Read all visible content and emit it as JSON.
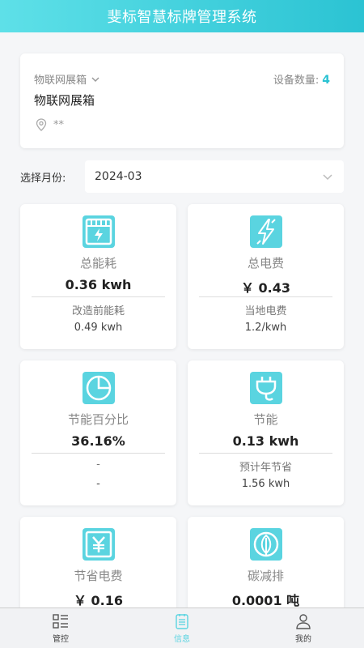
{
  "app": {
    "title": "斐标智慧标牌管理系统"
  },
  "device": {
    "selector_label": "物联网展箱",
    "count_label": "设备数量:",
    "count": "4",
    "name": "物联网展箱",
    "location": "**"
  },
  "month": {
    "label": "选择月份:",
    "value": "2024-03"
  },
  "cards": [
    {
      "title": "总能耗",
      "value": "0.36 kwh",
      "sub_label": "改造前能耗",
      "sub_value": "0.49 kwh",
      "icon": "meter-icon"
    },
    {
      "title": "总电费",
      "value": "￥ 0.43",
      "sub_label": "当地电费",
      "sub_value": "1.2/kwh",
      "icon": "lightning-icon"
    },
    {
      "title": "节能百分比",
      "value": "36.16%",
      "sub_label": "-",
      "sub_value": "-",
      "icon": "pie-chart-icon"
    },
    {
      "title": "节能",
      "value": "0.13 kwh",
      "sub_label": "预计年节省",
      "sub_value": "1.56 kwh",
      "icon": "plug-icon"
    },
    {
      "title": "节省电费",
      "value": "￥ 0.16",
      "sub_label": "",
      "sub_value": "",
      "icon": "yen-icon"
    },
    {
      "title": "碳减排",
      "value": "0.0001 吨",
      "sub_label": "",
      "sub_value": "",
      "icon": "leaf-icon"
    }
  ],
  "nav": [
    {
      "label": "管控",
      "icon": "grid-list-icon",
      "active": false
    },
    {
      "label": "信息",
      "icon": "document-icon",
      "active": true
    },
    {
      "label": "我的",
      "icon": "user-icon",
      "active": false
    }
  ],
  "colors": {
    "accent": "#2bc3d3",
    "icon_bg": "#5ad4e0"
  }
}
